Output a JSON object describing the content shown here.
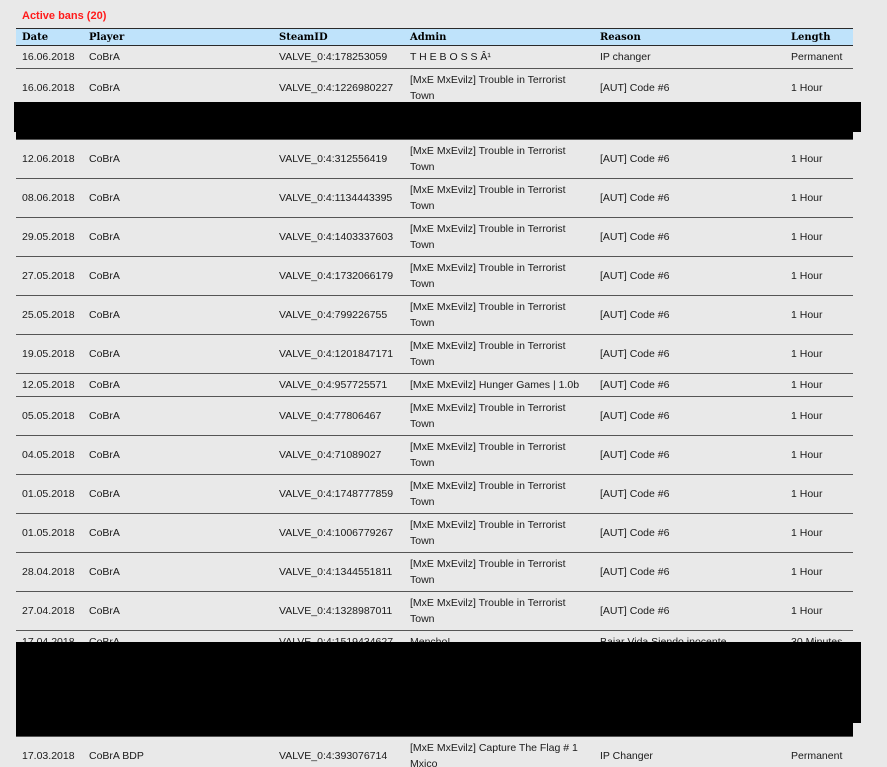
{
  "title": "Active bans (20)",
  "columns": [
    "Date",
    "Player",
    "SteamID",
    "Admin",
    "Reason",
    "Length"
  ],
  "rows": [
    {
      "date": "16.06.2018",
      "player": "CoBrA",
      "steamid": "VALVE_0:4:178253059",
      "admin": "T H E B O S S Â¹",
      "reason": "IP changer",
      "length": "Permanent"
    },
    {
      "date": "16.06.2018",
      "player": "CoBrA",
      "steamid": "VALVE_0:4:1226980227",
      "admin": "[MxE MxEvilz] Trouble in Terrorist Town",
      "reason": "[AUT] Code #6",
      "length": "1 Hour"
    },
    {
      "date": "12.06.2018",
      "player": "CoBrA",
      "steamid": "VALVE_0:4:312556419",
      "admin": "[MxE MxEvilz] Trouble in Terrorist Town",
      "reason": "[AUT] Code #6",
      "length": "1 Hour"
    },
    {
      "date": "08.06.2018",
      "player": "CoBrA",
      "steamid": "VALVE_0:4:1134443395",
      "admin": "[MxE MxEvilz] Trouble in Terrorist Town",
      "reason": "[AUT] Code #6",
      "length": "1 Hour"
    },
    {
      "date": "29.05.2018",
      "player": "CoBrA",
      "steamid": "VALVE_0:4:1403337603",
      "admin": "[MxE MxEvilz] Trouble in Terrorist Town",
      "reason": "[AUT] Code #6",
      "length": "1 Hour"
    },
    {
      "date": "27.05.2018",
      "player": "CoBrA",
      "steamid": "VALVE_0:4:1732066179",
      "admin": "[MxE MxEvilz] Trouble in Terrorist Town",
      "reason": "[AUT] Code #6",
      "length": "1 Hour"
    },
    {
      "date": "25.05.2018",
      "player": "CoBrA",
      "steamid": "VALVE_0:4:799226755",
      "admin": "[MxE MxEvilz] Trouble in Terrorist Town",
      "reason": "[AUT] Code #6",
      "length": "1 Hour"
    },
    {
      "date": "19.05.2018",
      "player": "CoBrA",
      "steamid": "VALVE_0:4:1201847171",
      "admin": "[MxE MxEvilz] Trouble in Terrorist Town",
      "reason": "[AUT] Code #6",
      "length": "1 Hour"
    },
    {
      "date": "12.05.2018",
      "player": "CoBrA",
      "steamid": "VALVE_0:4:957725571",
      "admin": "[MxE MxEvilz] Hunger Games | 1.0b",
      "reason": "[AUT] Code #6",
      "length": "1 Hour"
    },
    {
      "date": "05.05.2018",
      "player": "CoBrA",
      "steamid": "VALVE_0:4:77806467",
      "admin": "[MxE MxEvilz] Trouble in Terrorist Town",
      "reason": "[AUT] Code #6",
      "length": "1 Hour"
    },
    {
      "date": "04.05.2018",
      "player": "CoBrA",
      "steamid": "VALVE_0:4:71089027",
      "admin": "[MxE MxEvilz] Trouble in Terrorist Town",
      "reason": "[AUT] Code #6",
      "length": "1 Hour"
    },
    {
      "date": "01.05.2018",
      "player": "CoBrA",
      "steamid": "VALVE_0:4:1748777859",
      "admin": "[MxE MxEvilz] Trouble in Terrorist Town",
      "reason": "[AUT] Code #6",
      "length": "1 Hour"
    },
    {
      "date": "01.05.2018",
      "player": "CoBrA",
      "steamid": "VALVE_0:4:1006779267",
      "admin": "[MxE MxEvilz] Trouble in Terrorist Town",
      "reason": "[AUT] Code #6",
      "length": "1 Hour"
    },
    {
      "date": "28.04.2018",
      "player": "CoBrA",
      "steamid": "VALVE_0:4:1344551811",
      "admin": "[MxE MxEvilz] Trouble in Terrorist Town",
      "reason": "[AUT] Code #6",
      "length": "1 Hour"
    },
    {
      "date": "27.04.2018",
      "player": "CoBrA",
      "steamid": "VALVE_0:4:1328987011",
      "admin": "[MxE MxEvilz] Trouble in Terrorist Town",
      "reason": "[AUT] Code #6",
      "length": "1 Hour"
    },
    {
      "date": "17.04.2018",
      "player": "CoBrA",
      "steamid": "VALVE_0:4:1519434627",
      "admin": "Mencho!",
      "reason": "Bajar Vida Siendo inocente.",
      "length": "30 Minutes"
    },
    {
      "date": "17.03.2018",
      "player": "CoBrA BDP",
      "steamid": "VALVE_0:4:393076714",
      "admin": "[MxE MxEvilz] Capture The Flag # 1 Mxico",
      "reason": "IP Changer",
      "length": "Permanent"
    }
  ]
}
